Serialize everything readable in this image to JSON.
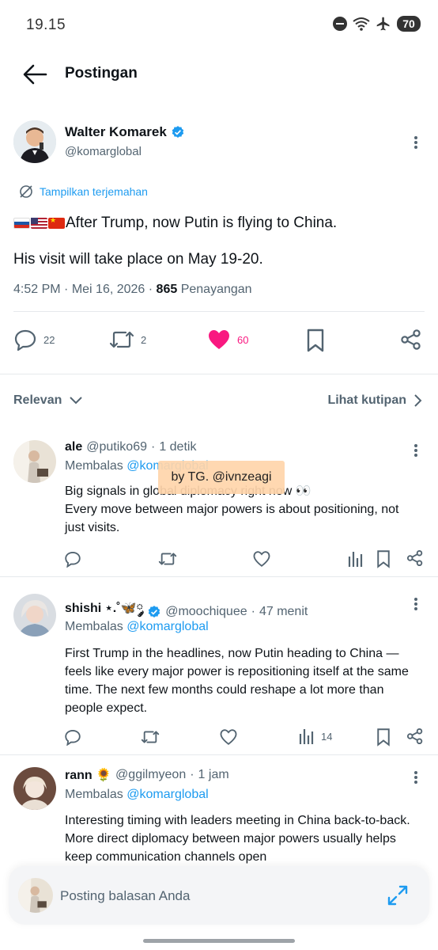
{
  "status_bar": {
    "time": "19.15",
    "battery": "70"
  },
  "header": {
    "title": "Postingan"
  },
  "main_post": {
    "author_name": "Walter Komarek",
    "author_handle": "@komarglobal",
    "translate_label": "Tampilkan terjemahan",
    "text_line1": "After Trump, now Putin is flying to China.",
    "text_line2": "His visit will take place on May 19-20.",
    "time": "4:52 PM",
    "date": "Mei 16, 2026",
    "views_count": "865",
    "views_label": "Penayangan",
    "replies": "22",
    "reposts": "2",
    "likes": "60"
  },
  "sort": {
    "relevance_label": "Relevan",
    "quotes_label": "Lihat kutipan"
  },
  "replies": [
    {
      "name": "ale",
      "handle": "@putiko69",
      "time": "1 detik",
      "replying_prefix": "Membalas",
      "replying_to": "@komarglobal",
      "text": "Big signals in global diplomacy right now 👀\nEvery move between major powers is about positioning, not just visits."
    },
    {
      "name": "shishi ⋆.˚🦋༘",
      "handle": "@moochiquee",
      "time": "47 menit",
      "replying_prefix": "Membalas",
      "replying_to": "@komarglobal",
      "text": "First Trump in the headlines, now Putin heading to China — feels like every major power is repositioning itself at the same time. The next few months could reshape a lot more than people expect.",
      "views": "14"
    },
    {
      "name": "rann 🌻",
      "handle": "@ggilmyeon",
      "time": "1 jam",
      "replying_prefix": "Membalas",
      "replying_to": "@komarglobal",
      "text": "Interesting timing with leaders meeting in China back-to-back. More direct diplomacy between major powers usually helps keep communication channels open"
    }
  ],
  "watermark": "by TG. @ivnzeagi",
  "composer": {
    "placeholder": "Posting balasan Anda"
  },
  "colors": {
    "accent": "#1d9bf0",
    "like": "#f91880",
    "secondary_text": "#536471"
  },
  "icons": [
    "back-arrow-icon",
    "verified-icon",
    "more-icon",
    "translate-icon",
    "reply-icon",
    "repost-icon",
    "heart-icon",
    "bookmark-icon",
    "share-icon",
    "chevron-down-icon",
    "chevron-right-icon",
    "views-icon",
    "expand-icon"
  ]
}
